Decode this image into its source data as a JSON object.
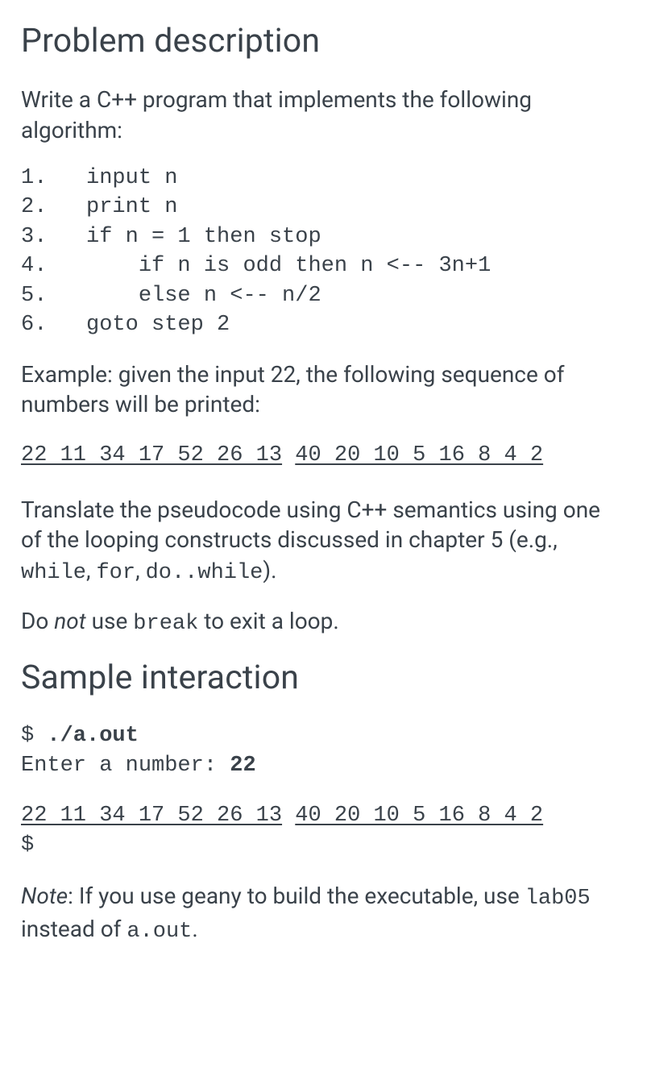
{
  "heading1": "Problem description",
  "intro": "Write a C++ program that implements the following algorithm:",
  "algo": "1.   input n\n2.   print n\n3.   if n = 1 then stop\n4.       if n is odd then n <-- 3n+1\n5.       else n <-- n/2\n6.   goto step 2",
  "example_lead": "Example: given the input 22, the following sequence of numbers will be printed:",
  "seq_a": "22 11 34 17 52 26 13",
  "seq_b": "40 20 10 5 16 8 4 2",
  "translate_a": "Translate the pseudocode using C++ semantics using one of the looping constructs discussed in chapter 5 (e.g., ",
  "kw_while": "while",
  "sep1": ", ",
  "kw_for": "for",
  "sep2": ", ",
  "kw_dowhile": "do..while",
  "translate_b": ").",
  "donot_a": "Do ",
  "donot_not": "not",
  "donot_b": " use ",
  "kw_break": "break",
  "donot_c": " to exit a loop.",
  "heading2": "Sample interaction",
  "sample": {
    "line1_a": "$ ",
    "line1_b": "./a.out",
    "line2_a": "Enter a number: ",
    "line2_b": "22",
    "line3_seq_a": "22 11 34 17 52 26 13",
    "line3_seq_b": "40 20 10 5 16 8 4 2",
    "line4": "$"
  },
  "note_label": "Note",
  "note_a": ": If you use geany to build the executable, use ",
  "note_lab": "lab05",
  "note_b": " instead of ",
  "note_aout": "a.out",
  "note_c": "."
}
